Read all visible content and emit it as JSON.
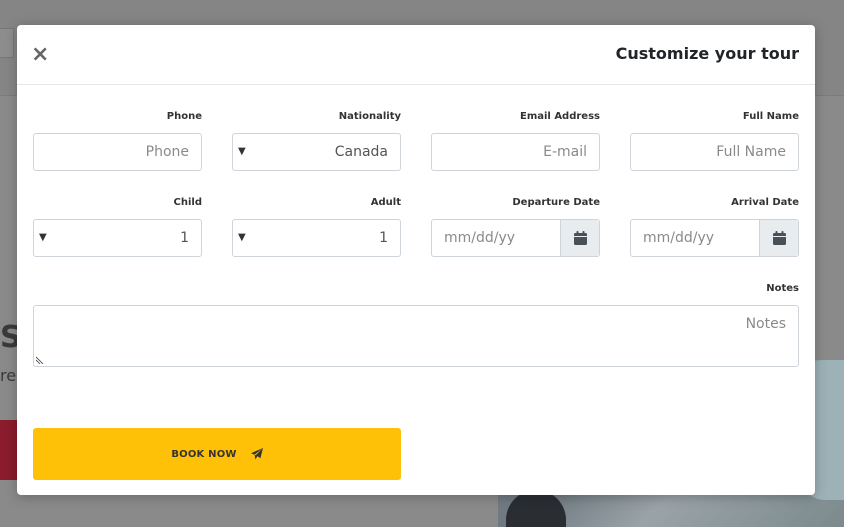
{
  "modal": {
    "title": "Customize your tour",
    "close_symbol": "×"
  },
  "fields": {
    "phone": {
      "label": "Phone",
      "placeholder": "Phone"
    },
    "nationality": {
      "label": "Nationality",
      "value": "Canada"
    },
    "email": {
      "label": "Email Address",
      "placeholder": "E-mail"
    },
    "full_name": {
      "label": "Full Name",
      "placeholder": "Full Name"
    },
    "child": {
      "label": "Child",
      "value": "1"
    },
    "adult": {
      "label": "Adult",
      "value": "1"
    },
    "departure_date": {
      "label": "Departure Date",
      "placeholder": "mm/dd/yy"
    },
    "arrival_date": {
      "label": "Arrival Date",
      "placeholder": "mm/dd/yy"
    },
    "notes": {
      "label": "Notes",
      "placeholder": "Notes"
    }
  },
  "actions": {
    "book_now_label": "BOOK NOW"
  },
  "icons": {
    "close": "close-icon",
    "calendar": "calendar-icon",
    "paper_plane": "paper-plane-icon",
    "dropdown_arrow": "caret-down-icon"
  },
  "colors": {
    "accent": "#ffc107",
    "overlay": "#7a7a7a",
    "input_border": "#ced4da",
    "addon_bg": "#e9ecef"
  }
}
